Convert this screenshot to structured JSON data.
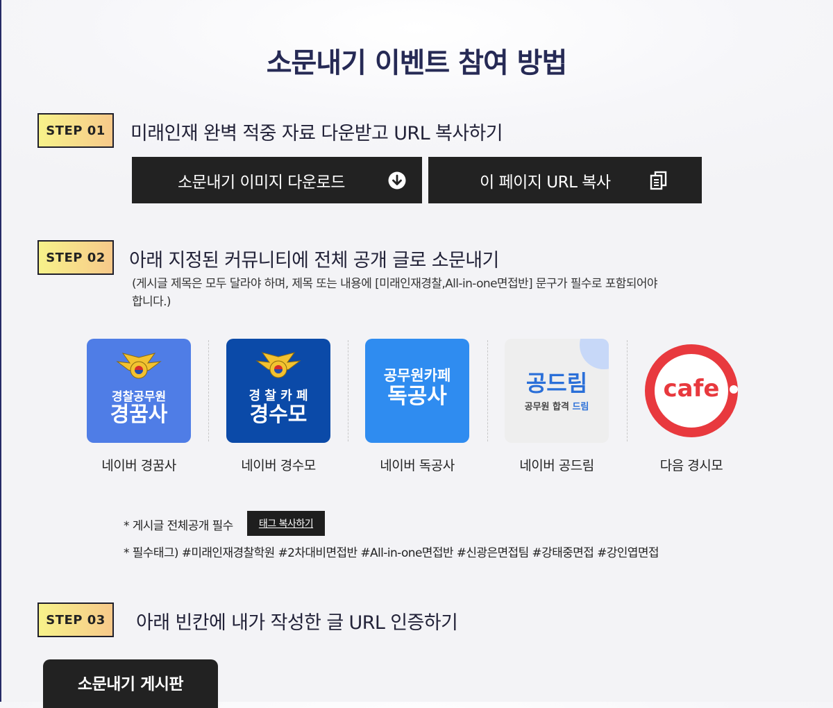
{
  "title": "소문내기 이벤트 참여 방법",
  "steps": [
    {
      "badge": "STEP 01",
      "text": "미래인재 완벽 적중 자료 다운받고 URL 복사하기"
    },
    {
      "badge": "STEP 02",
      "text": "아래 지정된 커뮤니티에 전체 공개 글로 소문내기",
      "note": "(게시글 제목은 모두 달라야 하며, 제목 또는 내용에 [미래인재경찰,All-in-one면접반] 문구가 필수로 포함되어야 합니다.)"
    },
    {
      "badge": "STEP 03",
      "text": "아래 빈칸에 내가 작성한 글 URL 인증하기"
    }
  ],
  "buttons": {
    "download": "소문내기 이미지 다운로드",
    "copy_url": "이 페이지 URL 복사"
  },
  "communities": [
    {
      "label": "네이버 경꿈사",
      "logo_top": "경찰공무원",
      "logo_main": "경꿈사",
      "bg": "#4f7de6"
    },
    {
      "label": "네이버 경수모",
      "logo_top": "경 찰 카 페",
      "logo_main": "경수모",
      "bg": "#0b4aa8"
    },
    {
      "label": "네이버 독공사",
      "logo_top": "공무원카페",
      "logo_main": "독공사",
      "bg": "#2f8cf0"
    },
    {
      "label": "네이버 공드림",
      "logo_main": "공드림",
      "logo_sub_a": "공무원 합격 ",
      "logo_sub_b": "드림",
      "bg": "#eeeeee"
    },
    {
      "label": "다음 경시모",
      "logo_main": "cafe",
      "ring": "#e8393e"
    }
  ],
  "notes": {
    "public_required": "* 게시글 전체공개 필수",
    "tag_button": "태그 복사하기",
    "tags": "* 필수태그) #미래인재경찰학원 #2차대비면접반 #All-in-one면접반 #신광은면접팀 #강태중면접 #강인엽면접"
  },
  "board_tab": "소문내기 게시판"
}
